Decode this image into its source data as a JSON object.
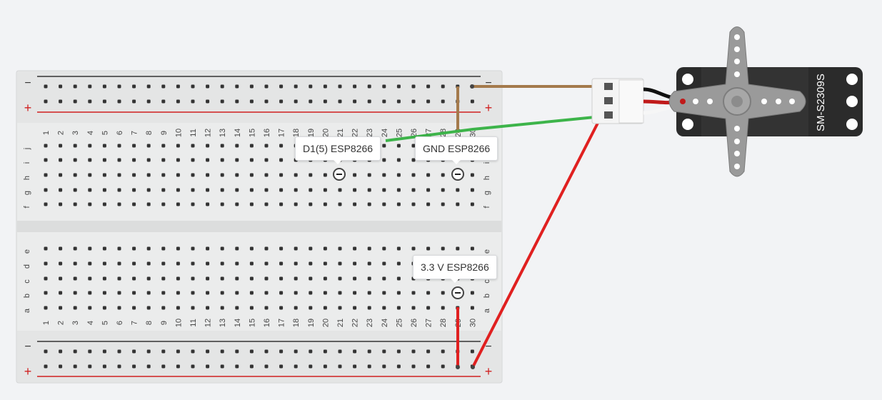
{
  "breadboard": {
    "columns": [
      "1",
      "2",
      "3",
      "4",
      "5",
      "6",
      "7",
      "8",
      "9",
      "10",
      "11",
      "12",
      "13",
      "14",
      "15",
      "16",
      "17",
      "18",
      "19",
      "20",
      "21",
      "22",
      "23",
      "24",
      "25",
      "26",
      "27",
      "28",
      "29",
      "30"
    ],
    "top_rows": [
      "j",
      "i",
      "h",
      "g",
      "f"
    ],
    "bottom_rows": [
      "e",
      "d",
      "c",
      "b",
      "a"
    ],
    "rail_minus": "−",
    "rail_plus": "+"
  },
  "callouts": {
    "d1": "D1(5) ESP8266",
    "gnd": "GND ESP8266",
    "v33": "3.3 V ESP8266"
  },
  "servo": {
    "label": "SM-S2309S"
  },
  "colors": {
    "wire_brown": "#a47a4c",
    "wire_green": "#3db44a",
    "wire_red": "#e02020",
    "rail_minus": "#333333",
    "rail_plus": "#d02020",
    "board": "#e9eaea",
    "hole": "#333333",
    "servo_body": "#2b2b2b",
    "servo_horn": "#9a9a9a"
  }
}
